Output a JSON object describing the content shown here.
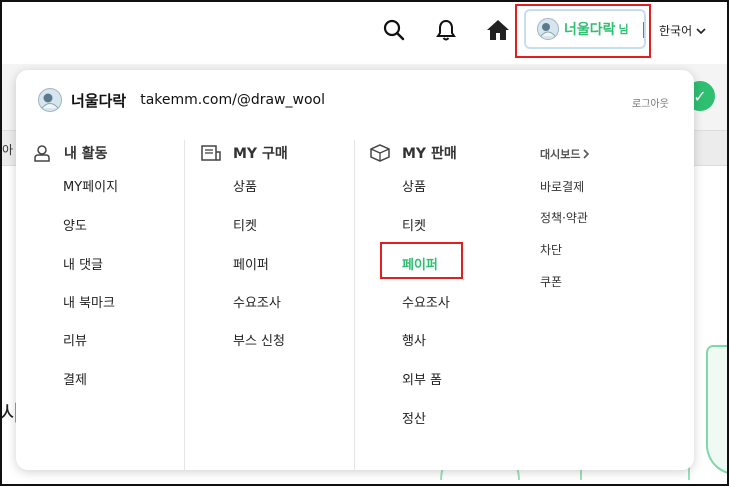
{
  "header": {
    "user_name": "너울다락",
    "user_suffix": "님",
    "language": "한국어"
  },
  "panel": {
    "user_name": "너울다락",
    "profile_url": "takemm.com/@draw_wool",
    "logout_label": "로그아웃",
    "columns": [
      {
        "title": "내 활동",
        "icon": "person-icon",
        "items": [
          "MY페이지",
          "양도",
          "내 댓글",
          "내 북마크",
          "리뷰",
          "결제"
        ]
      },
      {
        "title": "MY 구매",
        "icon": "receipt-icon",
        "items": [
          "상품",
          "티켓",
          "페이퍼",
          "수요조사",
          "부스 신청"
        ]
      },
      {
        "title": "MY 판매",
        "icon": "box-icon",
        "items": [
          "상품",
          "티켓",
          "페이퍼",
          "수요조사",
          "행사",
          "외부 폼",
          "정산"
        ],
        "active_item": "페이퍼"
      }
    ],
    "dashboard": {
      "label": "대시보드",
      "items": [
        "바로결제",
        "정책·약관",
        "차단",
        "쿠폰"
      ]
    }
  },
  "background": {
    "edge_char": "아",
    "edge_big_char": "시"
  },
  "colors": {
    "accent_green": "#2fbf71",
    "highlight_red": "#e02020"
  }
}
